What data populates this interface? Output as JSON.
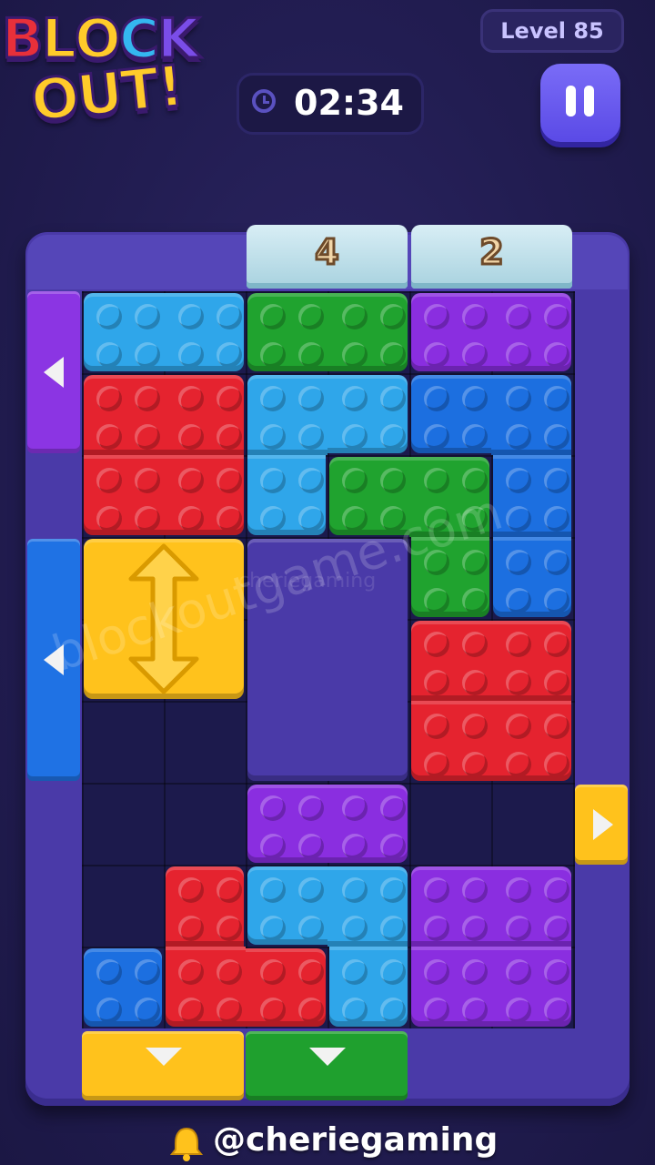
{
  "logo": {
    "line1": [
      "B",
      "L",
      "O",
      "C",
      "K"
    ],
    "line2": [
      "O",
      "U",
      "T",
      "!"
    ],
    "colors1": [
      "#e8303a",
      "#ffcb2a",
      "#ffcb2a",
      "#34b7f0",
      "#7a4de8"
    ],
    "colors2": [
      "#ffcb2a",
      "#ffcb2a",
      "#ffcb2a",
      "#ffcb2a"
    ]
  },
  "header": {
    "level_label": "Level 85",
    "timer": "02:34"
  },
  "board": {
    "exit_counters": [
      "4",
      "2"
    ],
    "watermark": "blockoutgame.com",
    "watermark_small": "cheriegaming"
  },
  "footer": {
    "handle": "@cheriegaming"
  },
  "colors": {
    "red": "#e5232f",
    "blue_light": "#2fa6ea",
    "blue_dark": "#1c6fe0",
    "green": "#20a32f",
    "purple": "#8a2ee0",
    "yellow": "#ffc21c"
  }
}
